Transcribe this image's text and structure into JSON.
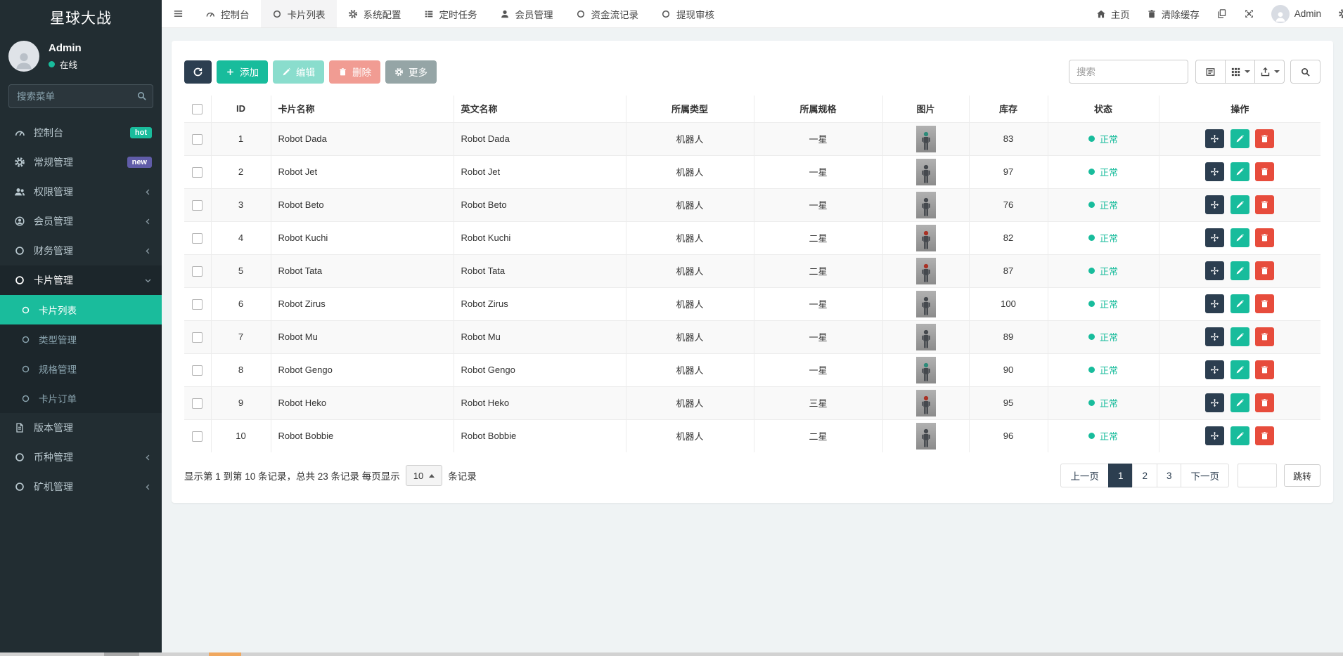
{
  "app": {
    "brand": "星球大战"
  },
  "colors": {
    "accent_teal": "#18bc9c",
    "primary_dark": "#2c3e50",
    "danger_red": "#e74c3c",
    "hot_badge": "#1abc9c",
    "new_badge": "#605ca8",
    "sidebar_bg": "#222d32"
  },
  "sidebar": {
    "user_name": "Admin",
    "user_status": "在线",
    "search_placeholder": "搜索菜单",
    "items": [
      {
        "label": "控制台",
        "badge": "hot"
      },
      {
        "label": "常规管理",
        "badge": "new"
      },
      {
        "label": "权限管理"
      },
      {
        "label": "会员管理"
      },
      {
        "label": "财务管理"
      },
      {
        "label": "卡片管理",
        "children": [
          {
            "label": "卡片列表"
          },
          {
            "label": "类型管理"
          },
          {
            "label": "规格管理"
          },
          {
            "label": "卡片订单"
          }
        ]
      },
      {
        "label": "版本管理"
      },
      {
        "label": "币种管理"
      },
      {
        "label": "矿机管理"
      }
    ]
  },
  "topnav": {
    "tabs": [
      {
        "label": "控制台"
      },
      {
        "label": "卡片列表"
      },
      {
        "label": "系统配置"
      },
      {
        "label": "定时任务"
      },
      {
        "label": "会员管理"
      },
      {
        "label": "资金流记录"
      },
      {
        "label": "提现审核"
      }
    ],
    "home_label": "主页",
    "clear_cache_label": "清除缓存",
    "user_name": "Admin"
  },
  "toolbar": {
    "add_label": "添加",
    "edit_label": "编辑",
    "delete_label": "删除",
    "more_label": "更多",
    "search_placeholder": "搜索"
  },
  "table": {
    "columns": [
      "ID",
      "卡片名称",
      "英文名称",
      "所属类型",
      "所属规格",
      "图片",
      "库存",
      "状态",
      "操作"
    ],
    "rows": [
      {
        "id": "1",
        "name": "Robot Dada",
        "name_en": "Robot Dada",
        "type": "机器人",
        "spec": "一星",
        "stock": "83",
        "status": "正常"
      },
      {
        "id": "2",
        "name": "Robot Jet",
        "name_en": "Robot Jet",
        "type": "机器人",
        "spec": "一星",
        "stock": "97",
        "status": "正常"
      },
      {
        "id": "3",
        "name": "Robot Beto",
        "name_en": "Robot Beto",
        "type": "机器人",
        "spec": "一星",
        "stock": "76",
        "status": "正常"
      },
      {
        "id": "4",
        "name": "Robot Kuchi",
        "name_en": "Robot Kuchi",
        "type": "机器人",
        "spec": "二星",
        "stock": "82",
        "status": "正常"
      },
      {
        "id": "5",
        "name": "Robot Tata",
        "name_en": "Robot Tata",
        "type": "机器人",
        "spec": "二星",
        "stock": "87",
        "status": "正常"
      },
      {
        "id": "6",
        "name": "Robot Zirus",
        "name_en": "Robot Zirus",
        "type": "机器人",
        "spec": "一星",
        "stock": "100",
        "status": "正常"
      },
      {
        "id": "7",
        "name": "Robot Mu",
        "name_en": "Robot Mu",
        "type": "机器人",
        "spec": "一星",
        "stock": "89",
        "status": "正常"
      },
      {
        "id": "8",
        "name": "Robot Gengo",
        "name_en": "Robot Gengo",
        "type": "机器人",
        "spec": "一星",
        "stock": "90",
        "status": "正常"
      },
      {
        "id": "9",
        "name": "Robot Heko",
        "name_en": "Robot Heko",
        "type": "机器人",
        "spec": "三星",
        "stock": "95",
        "status": "正常"
      },
      {
        "id": "10",
        "name": "Robot Bobbie",
        "name_en": "Robot Bobbie",
        "type": "机器人",
        "spec": "二星",
        "stock": "96",
        "status": "正常"
      }
    ]
  },
  "pagination": {
    "summary_prefix": "显示第 1 到第 10 条记录，总共 23 条记录 每页显示",
    "page_size": "10",
    "summary_suffix": "条记录",
    "prev_label": "上一页",
    "pages": [
      "1",
      "2",
      "3"
    ],
    "active_page": "1",
    "next_label": "下一页",
    "jump_label": "跳转"
  }
}
